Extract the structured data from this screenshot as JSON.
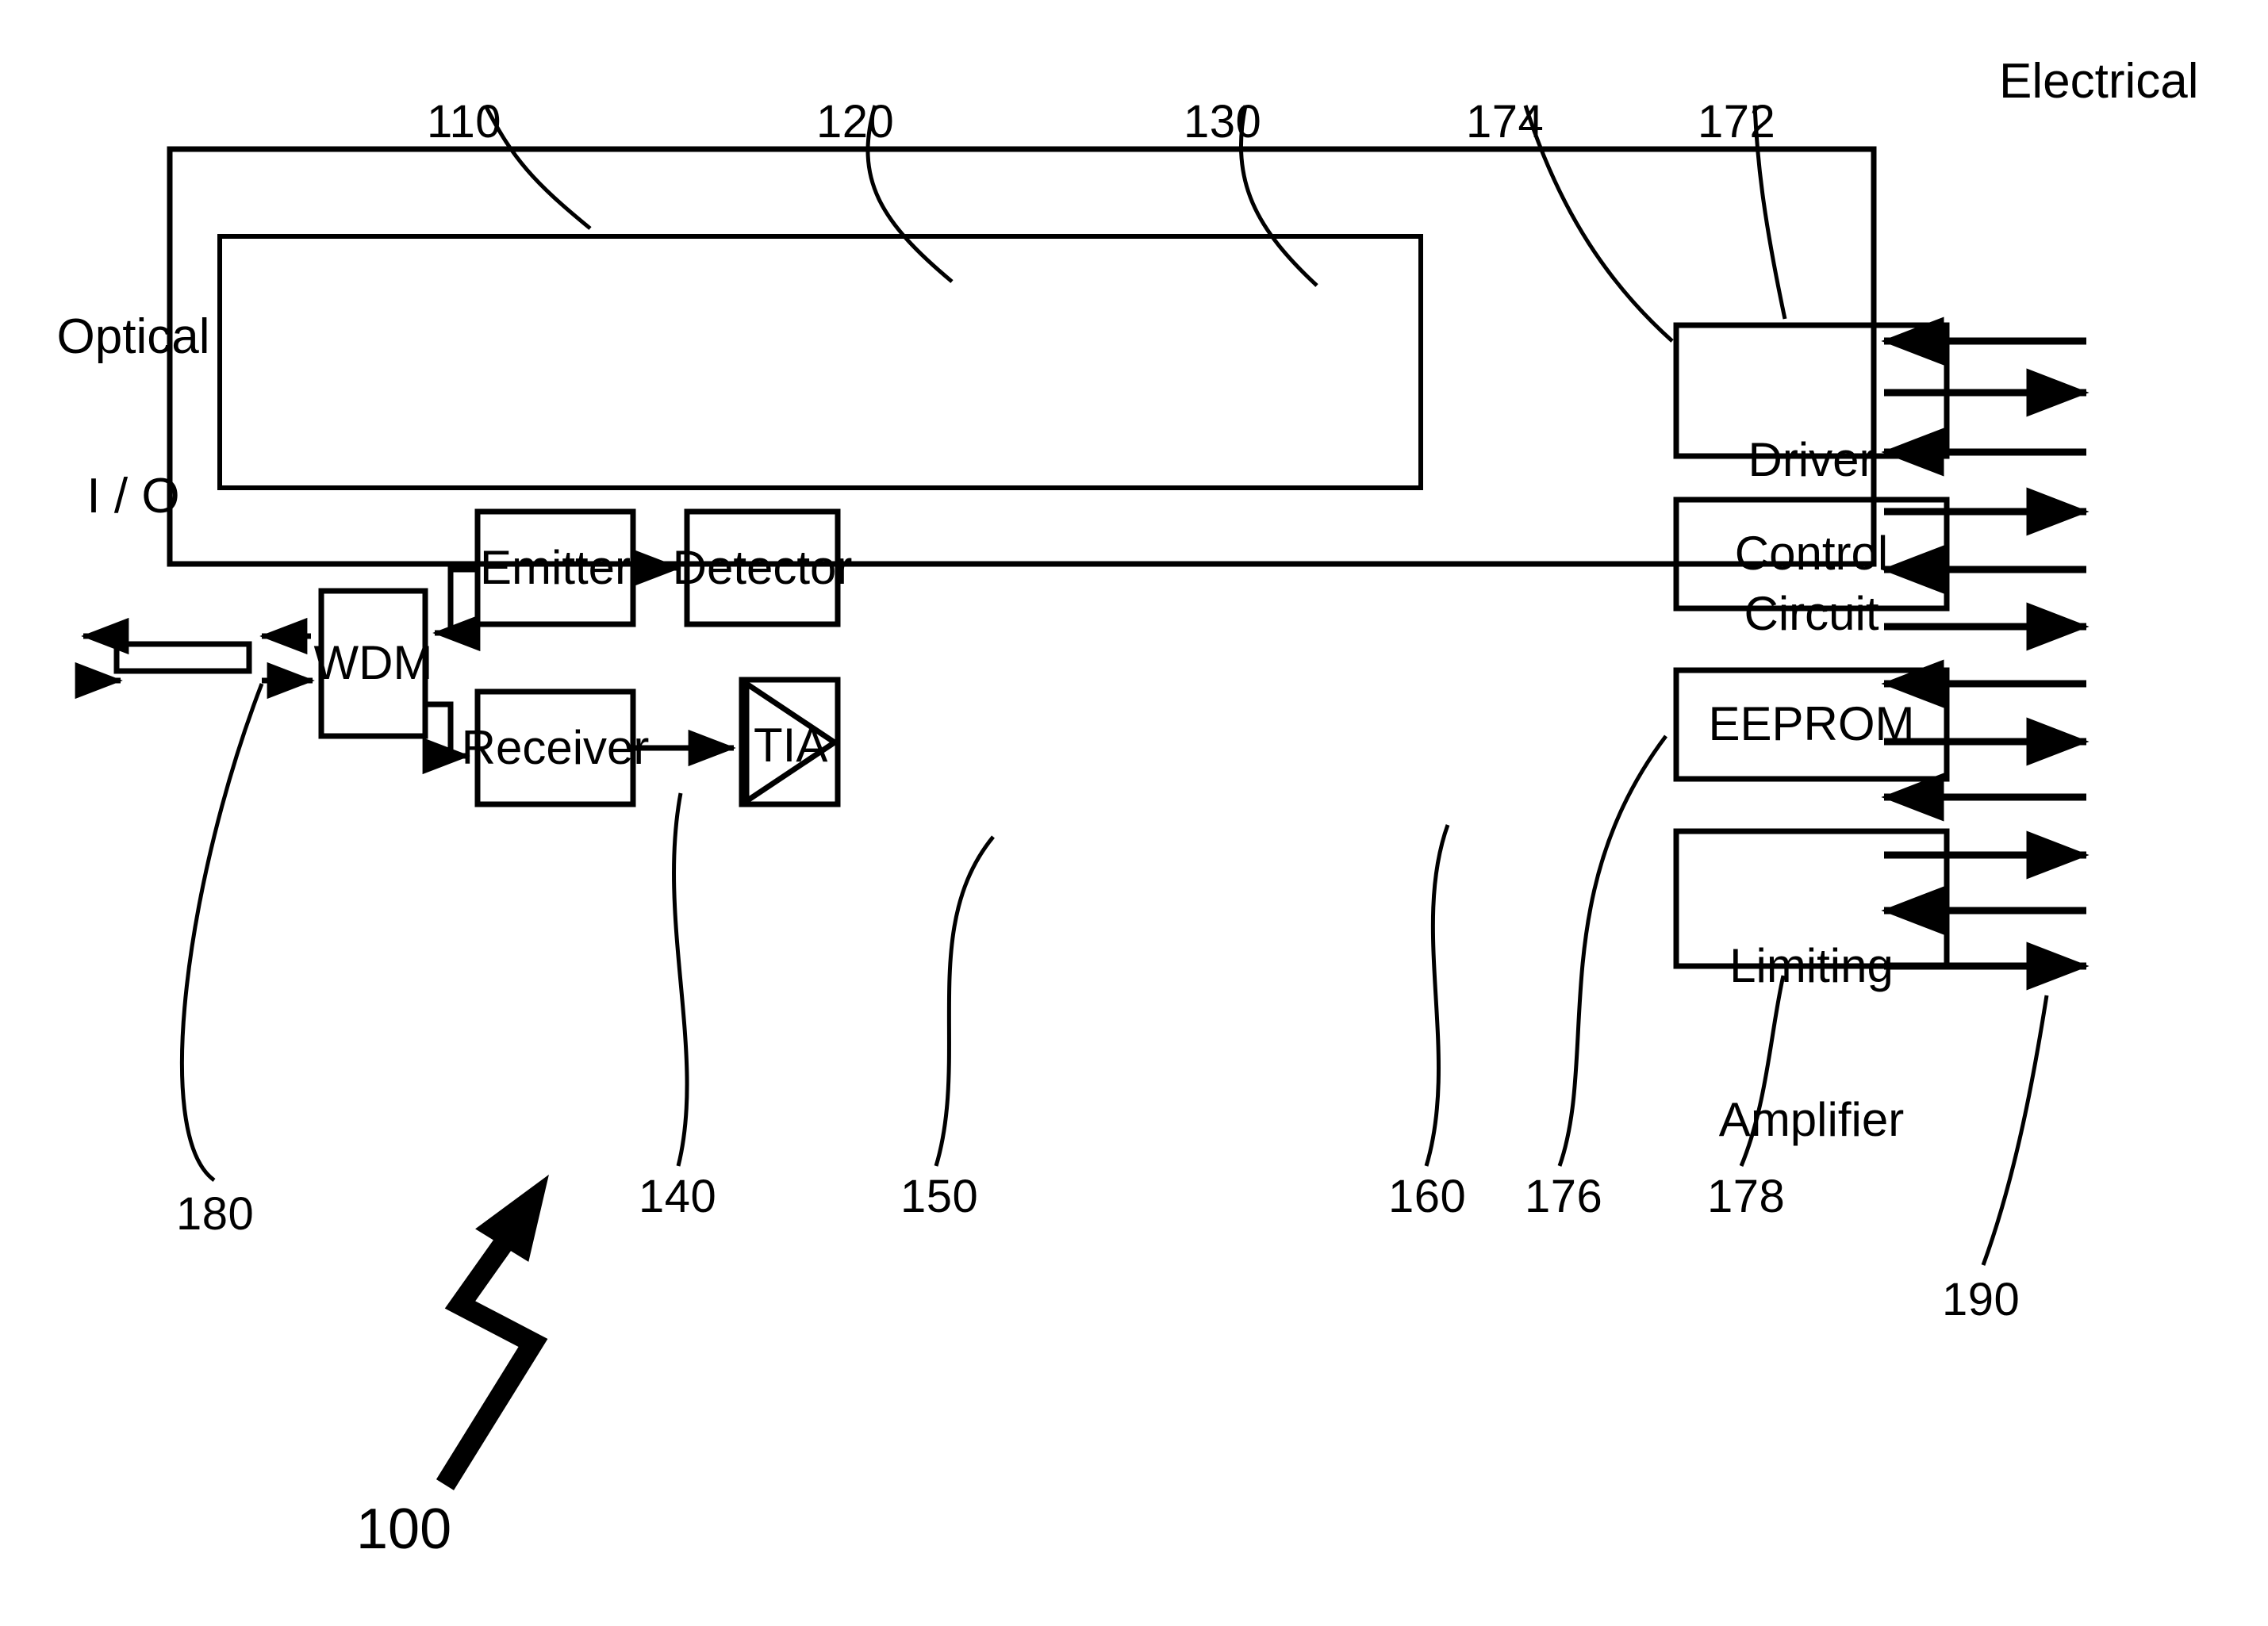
{
  "figure": {
    "title_number": "100",
    "side_labels": {
      "optical_io": "Optical\nI / O",
      "optical_io_line1": "Optical",
      "optical_io_line2": "I / O",
      "electrical": "Electrical"
    },
    "blocks": [
      {
        "id": "wdm",
        "label": "WDM"
      },
      {
        "id": "emitter",
        "label": "Emitter"
      },
      {
        "id": "detector",
        "label": "Detector"
      },
      {
        "id": "receiver",
        "label": "Receiver"
      },
      {
        "id": "tia",
        "label": "TIA"
      },
      {
        "id": "driver",
        "label": "Driver\nCircuit"
      },
      {
        "id": "driver_l1",
        "label": "Driver"
      },
      {
        "id": "driver_l2",
        "label": "Circuit"
      },
      {
        "id": "control",
        "label": "Control"
      },
      {
        "id": "eeprom",
        "label": "EEPROM"
      },
      {
        "id": "limamp",
        "label": "Limiting\nAmplifier"
      },
      {
        "id": "limamp_l1",
        "label": "Limiting"
      },
      {
        "id": "limamp_l2",
        "label": "Amplifier"
      }
    ],
    "reference_numerals": {
      "top": [
        {
          "number": "110",
          "points_to": "outer-housing"
        },
        {
          "number": "120",
          "points_to": "emitter"
        },
        {
          "number": "130",
          "points_to": "detector"
        },
        {
          "number": "174",
          "points_to": "control"
        },
        {
          "number": "172",
          "points_to": "driver-circuit"
        }
      ],
      "bottom": [
        {
          "number": "180",
          "points_to": "optical-connector"
        },
        {
          "number": "140",
          "points_to": "wdm"
        },
        {
          "number": "150",
          "points_to": "receiver"
        },
        {
          "number": "160",
          "points_to": "tia"
        },
        {
          "number": "176",
          "points_to": "eeprom"
        },
        {
          "number": "178",
          "points_to": "limiting-amplifier"
        },
        {
          "number": "190",
          "points_to": "electrical-interface"
        }
      ]
    },
    "electrical_interface": {
      "arrow_count": 12,
      "directions": [
        "in",
        "out",
        "in",
        "out",
        "in",
        "out",
        "in",
        "out",
        "in",
        "out",
        "in",
        "out"
      ]
    },
    "colors": {
      "stroke": "#000000",
      "background": "#ffffff"
    }
  }
}
